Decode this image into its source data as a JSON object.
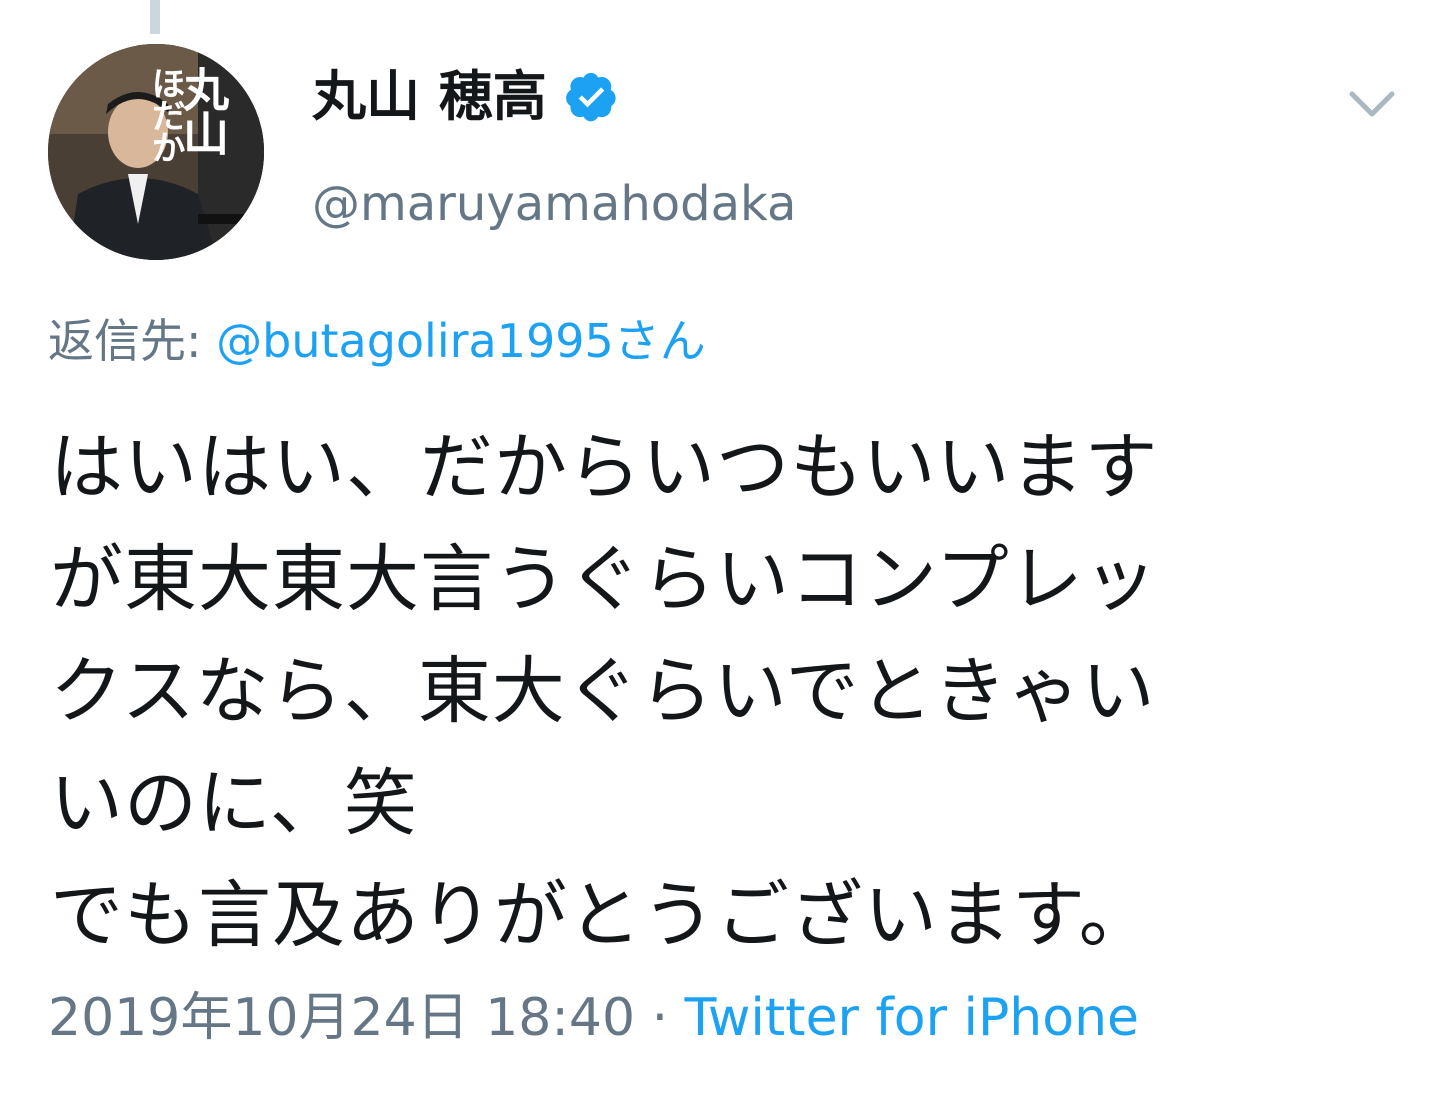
{
  "tweet": {
    "avatar": {
      "label_big": "丸山",
      "label_small": "ほだか",
      "icon": "avatar-photo"
    },
    "author": {
      "display_name": "丸山 穂高",
      "verified": true,
      "verified_icon": "verified-badge-icon",
      "username": "@maruyamahodaka"
    },
    "menu_icon": "chevron-down-icon",
    "reply": {
      "label": "返信先: ",
      "target": "@butagolira1995さん"
    },
    "text_lines": [
      "はいはい、だからいつもいいます",
      "が東大東大言うぐらいコンプレッ",
      "クスなら、東大ぐらいでときゃい",
      "いのに、笑",
      "でも言及ありがとうございます。"
    ],
    "timestamp": "2019年10月24日 18:40",
    "separator": " · ",
    "source": "Twitter for iPhone"
  },
  "colors": {
    "text": "#14171a",
    "secondary": "#657786",
    "accent": "#1da1f2",
    "thread_line": "#ccd6dd"
  }
}
